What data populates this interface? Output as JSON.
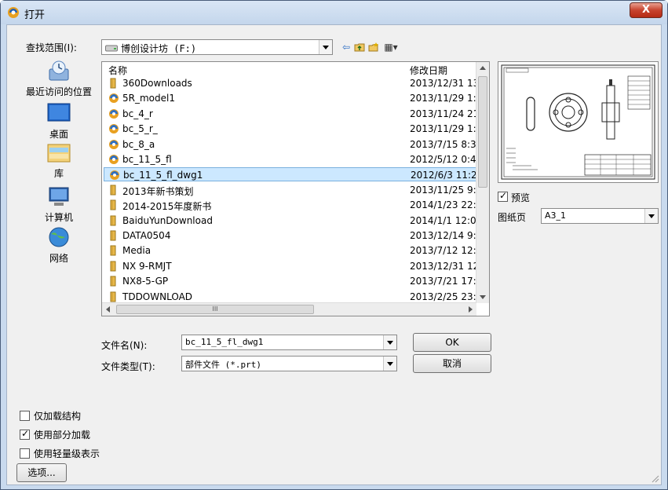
{
  "window": {
    "title": "打开",
    "close_label": "X"
  },
  "lookin": {
    "label": "查找范围(I):",
    "value": "博创设计坊 (F:)"
  },
  "toolbar": {
    "back_glyph": "⇦",
    "up_glyph": "⬆",
    "newfolder_glyph": "✱",
    "views_glyph": "▦▾"
  },
  "places": [
    {
      "label": "最近访问的位置",
      "icon": "recent-places-icon"
    },
    {
      "label": "桌面",
      "icon": "desktop-icon"
    },
    {
      "label": "库",
      "icon": "library-icon"
    },
    {
      "label": "计算机",
      "icon": "computer-icon"
    },
    {
      "label": "网络",
      "icon": "network-icon"
    }
  ],
  "filelist": {
    "col_name": "名称",
    "col_date": "修改日期",
    "hscroll_grip": "III",
    "items": [
      {
        "name": "360Downloads",
        "date": "2013/12/31 13",
        "type": "folder"
      },
      {
        "name": "5R_model1",
        "date": "2013/11/29 1:1",
        "type": "part"
      },
      {
        "name": "bc_4_r",
        "date": "2013/11/24 21",
        "type": "part"
      },
      {
        "name": "bc_5_r_",
        "date": "2013/11/29 1:1",
        "type": "part"
      },
      {
        "name": "bc_8_a",
        "date": "2013/7/15 8:39",
        "type": "part"
      },
      {
        "name": "bc_11_5_fl",
        "date": "2012/5/12 0:40",
        "type": "part"
      },
      {
        "name": "bc_11_5_fl_dwg1",
        "date": "2012/6/3 11:28",
        "type": "part",
        "selected": true
      },
      {
        "name": "2013年新书策划",
        "date": "2013/11/25 9:3",
        "type": "folder"
      },
      {
        "name": "2014-2015年度新书",
        "date": "2014/1/23 22:2",
        "type": "folder"
      },
      {
        "name": "BaiduYunDownload",
        "date": "2014/1/1 12:02",
        "type": "folder"
      },
      {
        "name": "DATA0504",
        "date": "2013/12/14 9:4",
        "type": "folder"
      },
      {
        "name": "Media",
        "date": "2013/7/12 12:1",
        "type": "folder"
      },
      {
        "name": "NX 9-RMJT",
        "date": "2013/12/31 12",
        "type": "folder"
      },
      {
        "name": "NX8-5-GP",
        "date": "2013/7/21 17:0",
        "type": "folder"
      },
      {
        "name": "TDDOWNLOAD",
        "date": "2013/2/25 23:0",
        "type": "folder"
      }
    ]
  },
  "preview": {
    "check_label": "预览",
    "checked": true,
    "sheet_label": "图纸页",
    "sheet_value": "A3_1"
  },
  "filename": {
    "label": "文件名(N):",
    "value": "bc_11_5_fl_dwg1"
  },
  "filetype": {
    "label": "文件类型(T):",
    "value": "部件文件 (*.prt)"
  },
  "buttons": {
    "ok": "OK",
    "cancel": "取消",
    "options": "选项..."
  },
  "options": [
    {
      "label": "仅加载结构",
      "checked": false
    },
    {
      "label": "使用部分加载",
      "checked": true
    },
    {
      "label": "使用轻量级表示",
      "checked": false
    }
  ],
  "colors": {
    "selection": "#cce8ff",
    "folder": "#e8b84a",
    "part": "#2f6fc0"
  }
}
